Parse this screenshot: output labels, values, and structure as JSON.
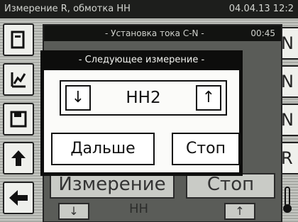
{
  "base": {
    "title": "Измерение R, обмотка НН",
    "datetime": "04.04.13 12:2",
    "right_letters": [
      "N",
      "N",
      "N",
      "R"
    ],
    "icons": [
      "document-icon",
      "chart-icon",
      "save-icon",
      "upload-icon",
      "back-arrow-icon"
    ],
    "thermometer_icon": "thermometer-icon"
  },
  "mid_dialog": {
    "title": "- Установка тока С-N -",
    "time": "00:45",
    "measure_label": "Измерение",
    "stop_label": "Стоп",
    "bottom_value": "НН",
    "arrow_down": "↓",
    "arrow_up": "↑"
  },
  "dialog": {
    "title": "- Следующее измерение -",
    "value": "НН2",
    "arrow_down": "↓",
    "arrow_up": "↑",
    "next_label": "Дальше",
    "stop_label": "Стоп"
  }
}
